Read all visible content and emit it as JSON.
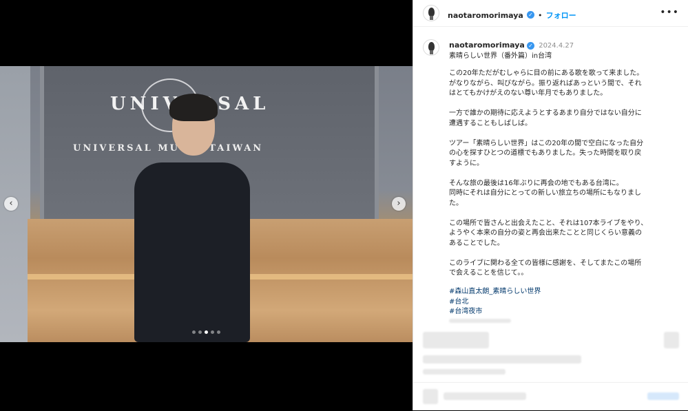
{
  "post": {
    "username": "naotaromorimaya",
    "follow_label": "フォロー",
    "separator": "•",
    "more_label": "•••",
    "date": "2024.4.27",
    "title": "素晴らしい世界（番外篇）in台湾",
    "body": "この20年ただがむしゃらに目の前にある歌を歌って来ました。\nがなりながら、叫びながら。振り返ればあっという間で、それ\nはとてもかけがえのない尊い年月でもありました。\n\n一方で誰かの期待に応えようとするあまり自分ではない自分に\n遭遇することもしばしば。\n\nツアー「素晴らしい世界」はこの20年の間で空白になった自分\nの心を探すひとつの道標でもありました。失った時間を取り戻\nすように。\n\nそんな旅の最後は16年ぶりに再会の地でもある台湾に。\n同時にそれは自分にとっての新しい旅立ちの場所にもなりまし\nた。\n\nこの場所で皆さんと出会えたこと、それは107本ライブをやり、\nようやく本来の自分の姿と再会出来たことと同じくらい意義の\nあることでした。\n\nこのライブに関わる全ての皆様に感謝を、そしてまたこの場所\nで会えることを信じて。。",
    "hashtags": [
      "#森山直太朗_素晴らしい世界",
      "#台北",
      "#台湾夜市"
    ]
  },
  "photo": {
    "sign_main": "UNIVERSAL",
    "sign_sub": "UNIVERSAL MUSIC TAIWAN",
    "prev_label": "‹",
    "next_label": "›"
  },
  "colors": {
    "link": "#0095f6",
    "hashtag": "#00376b",
    "text": "#262626"
  }
}
